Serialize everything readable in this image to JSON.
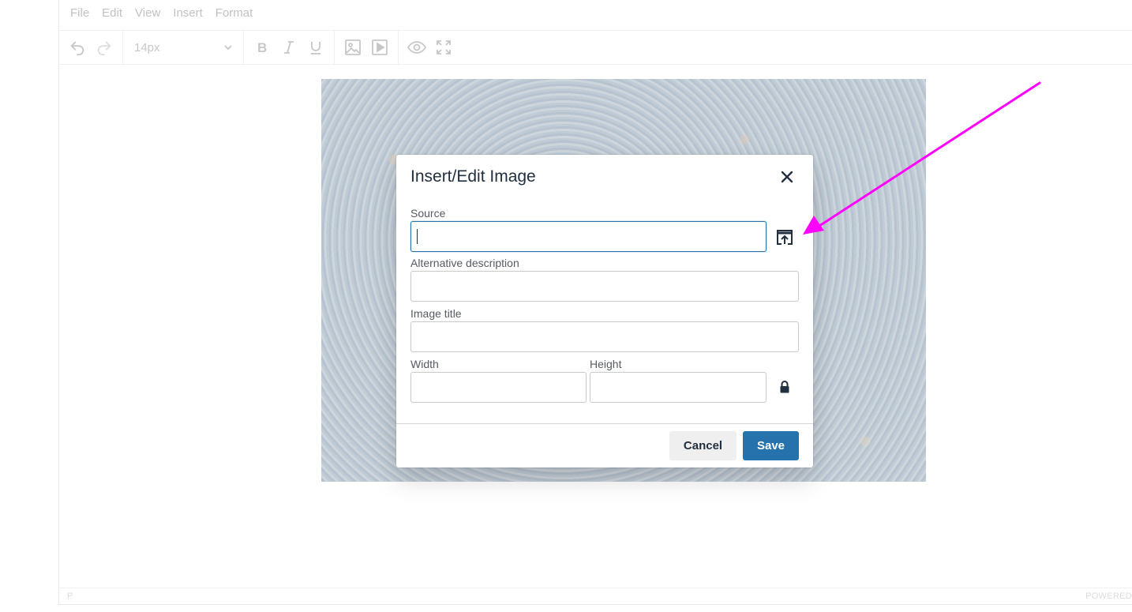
{
  "menubar": {
    "items": [
      "File",
      "Edit",
      "View",
      "Insert",
      "Format"
    ]
  },
  "toolbar": {
    "font_size": "14px",
    "buttons": [
      "undo-icon",
      "redo-icon",
      "bold-icon",
      "italic-icon",
      "underline-icon",
      "image-icon",
      "media-icon",
      "preview-icon",
      "fullscreen-icon"
    ]
  },
  "statusbar": {
    "path": "P",
    "powered": "POWERED"
  },
  "dialog": {
    "title": "Insert/Edit Image",
    "source_label": "Source",
    "source_value": "",
    "alt_label": "Alternative description",
    "alt_value": "",
    "title_label": "Image title",
    "title_value": "",
    "width_label": "Width",
    "width_value": "",
    "height_label": "Height",
    "height_value": "",
    "cancel_label": "Cancel",
    "save_label": "Save"
  },
  "colors": {
    "primary": "#2672ad",
    "annotation_arrow": "#ff00ff",
    "text": "#222f3e"
  }
}
